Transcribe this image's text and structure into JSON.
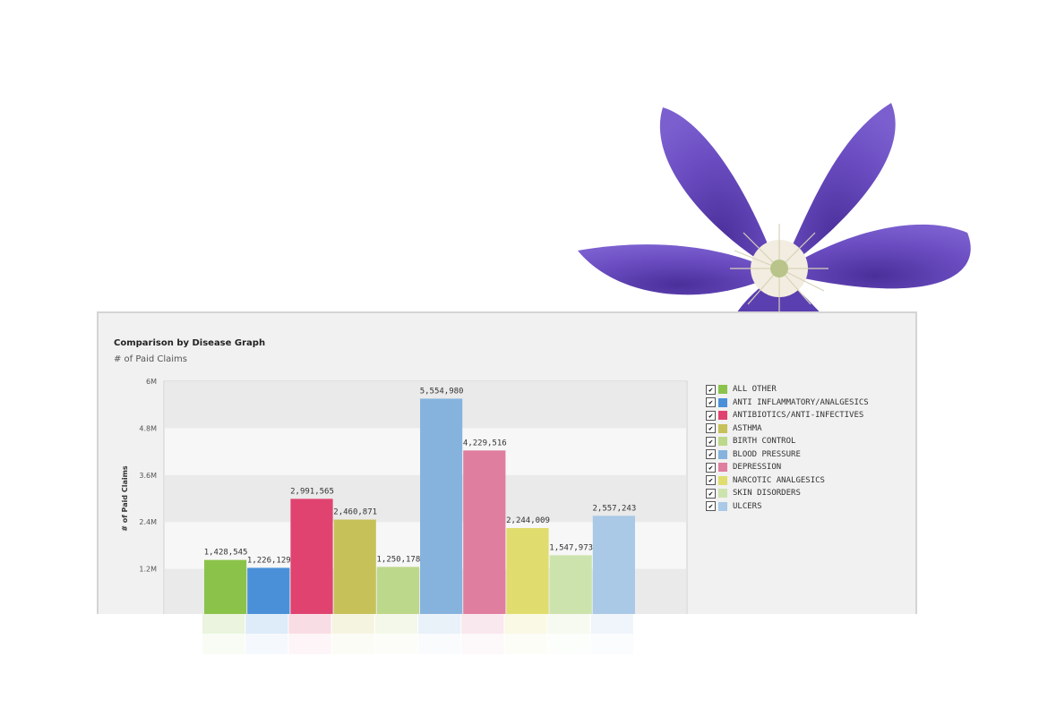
{
  "chart": {
    "title": "Comparison by Disease Graph",
    "subtitle": "# of Paid Claims"
  },
  "chart_data": {
    "type": "bar",
    "title": "Comparison by Disease Graph",
    "subtitle": "# of Paid Claims",
    "ylabel": "# of Paid Claims",
    "xlabel": "",
    "ylim": [
      0,
      6000000
    ],
    "yticks": [
      0,
      1200000,
      2400000,
      3600000,
      4800000,
      6000000
    ],
    "ytick_labels": [
      "",
      "1.2M",
      "2.4M",
      "3.6M",
      "4.8M",
      "6M"
    ],
    "grid": "alternating horizontal bands",
    "legend_position": "right",
    "categories": [
      "ALL OTHER",
      "ANTI INFLAMMATORY/ANALGESICS",
      "ANTIBIOTICS/ANTI-INFECTIVES",
      "ASTHMA",
      "BIRTH CONTROL",
      "BLOOD PRESSURE",
      "DEPRESSION",
      "NARCOTIC ANALGESICS",
      "SKIN DISORDERS",
      "ULCERS"
    ],
    "values": [
      1428545,
      1226129,
      2991565,
      2460871,
      1250178,
      5554980,
      4229516,
      2244009,
      1547973,
      2557243
    ],
    "value_labels": [
      "1,428,545",
      "1,226,129",
      "2,991,565",
      "2,460,871",
      "1,250,178",
      "5,554,980",
      "4,229,516",
      "2,244,009",
      "1,547,973",
      "2,557,243"
    ],
    "colors": [
      "#8bc34a",
      "#4a90d9",
      "#e0436f",
      "#c7c15a",
      "#bcd88a",
      "#85b3de",
      "#e07e9f",
      "#e0dd6e",
      "#cde3ae",
      "#a9c9e6"
    ],
    "checked": [
      true,
      true,
      true,
      true,
      true,
      true,
      true,
      true,
      true,
      true
    ]
  },
  "icons": {
    "flower": "purple-clematis-flower-image",
    "legend_check": "checkbox-checked-icon"
  }
}
